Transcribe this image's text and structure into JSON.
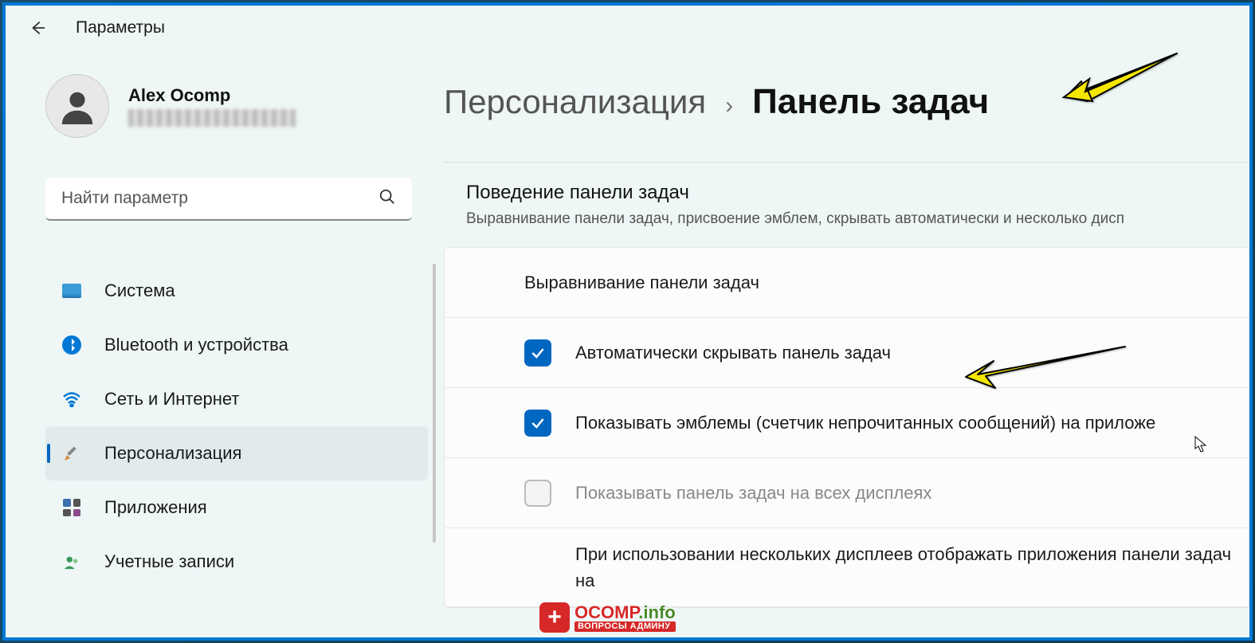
{
  "app_title": "Параметры",
  "user": {
    "name": "Alex Ocomp"
  },
  "search": {
    "placeholder": "Найти параметр"
  },
  "nav": [
    {
      "label": "Система",
      "icon": "system",
      "selected": false
    },
    {
      "label": "Bluetooth и устройства",
      "icon": "bluetooth",
      "selected": false
    },
    {
      "label": "Сеть и Интернет",
      "icon": "wifi",
      "selected": false
    },
    {
      "label": "Персонализация",
      "icon": "personalization",
      "selected": true
    },
    {
      "label": "Приложения",
      "icon": "apps",
      "selected": false
    },
    {
      "label": "Учетные записи",
      "icon": "accounts",
      "selected": false
    }
  ],
  "breadcrumb": {
    "parent": "Персонализация",
    "current": "Панель задач"
  },
  "section": {
    "title": "Поведение панели задач",
    "subtitle": "Выравнивание панели задач, присвоение эмблем, скрывать автоматически и несколько дисп"
  },
  "settings": {
    "alignment_label": "Выравнивание панели задач",
    "auto_hide": {
      "label": "Автоматически скрывать панель задач",
      "checked": true
    },
    "show_badges": {
      "label": "Показывать эмблемы (счетчик непрочитанных сообщений) на приложе",
      "checked": true
    },
    "all_displays": {
      "label": "Показывать панель задач на всех дисплеях",
      "checked": false,
      "disabled": true
    },
    "multi_display": {
      "label": "При использовании нескольких дисплеев отображать приложения панели задач на"
    }
  },
  "watermark": {
    "main": "OCOMP",
    "info": ".info",
    "sub": "ВОПРОСЫ АДМИНУ"
  },
  "colors": {
    "accent": "#0067c0",
    "arrow": "#f5e600"
  }
}
